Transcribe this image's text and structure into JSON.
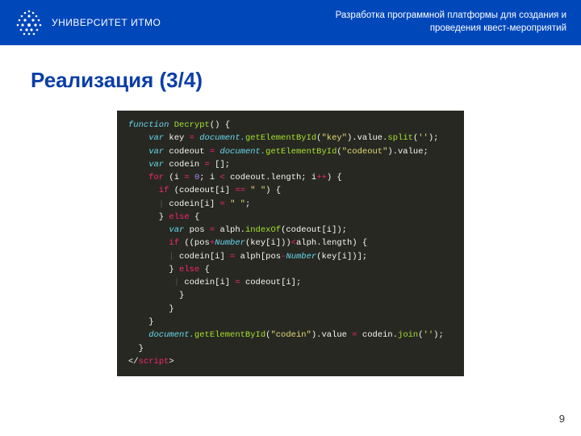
{
  "header": {
    "university": "УНИВЕРСИТЕТ ИТМО",
    "description_line1": "Разработка программной платформы для создания и",
    "description_line2": "проведения квест-мероприятий"
  },
  "slide": {
    "title": "Реализация (3/4)",
    "page_number": "9"
  },
  "code": {
    "l1a": "function",
    "l1b": " Decrypt",
    "l1c": "() {",
    "l2a": "    var",
    "l2b": " key ",
    "l2c": "=",
    "l2d": " document.",
    "l2e": "getElementById",
    "l2f": "(",
    "l2g": "\"key\"",
    "l2h": ").value.",
    "l2i": "split",
    "l2j": "(",
    "l2k": "''",
    "l2l": ");",
    "l3a": "    var",
    "l3b": " codeout ",
    "l3c": "=",
    "l3d": " document.",
    "l3e": "getElementById",
    "l3f": "(",
    "l3g": "\"codeout\"",
    "l3h": ").value;",
    "l4a": "    var",
    "l4b": " codein ",
    "l4c": "=",
    "l4d": " [];",
    "l5a": "    for",
    "l5b": " (i ",
    "l5c": "=",
    "l5d": " ",
    "l5e": "0",
    "l5f": "; i ",
    "l5g": "<",
    "l5h": " codeout.length; i",
    "l5i": "++",
    "l5j": ") {",
    "l6a": "      if",
    "l6b": " (codeout[i] ",
    "l6c": "==",
    "l6d": " ",
    "l6e": "\" \"",
    "l6f": ") {",
    "l7a": "      ",
    "l7g": "|",
    "l7b": " codein[i] ",
    "l7c": "=",
    "l7d": " ",
    "l7e": "\" \"",
    "l7f": ";",
    "l8a": "      } ",
    "l8b": "else",
    "l8c": " {",
    "l9a": "        var",
    "l9b": " pos ",
    "l9c": "=",
    "l9d": " alph.",
    "l9e": "indexOf",
    "l9f": "(codeout[i]);",
    "l10a": "        if",
    "l10b": " ((pos",
    "l10c": "+",
    "l10d": "Number",
    "l10e": "(key[i]))",
    "l10f": "<",
    "l10g": "alph.length) {",
    "l11a": "        ",
    "l11g": "|",
    "l11b": " codein[i] ",
    "l11c": "=",
    "l11d": " alph[pos",
    "l11e": "-",
    "l11f": "Number",
    "l11h": "(key[i])];",
    "l12a": "        } ",
    "l12b": "else",
    "l12c": " {",
    "l13a": "         ",
    "l13g": "|",
    "l13b": " codein[i] ",
    "l13c": "=",
    "l13d": " codeout[i];",
    "l14a": "          }",
    "l15a": "        }",
    "l16a": "    }",
    "l17a": "    document.",
    "l17b": "getElementById",
    "l17c": "(",
    "l17d": "\"codein\"",
    "l17e": ").value ",
    "l17f": "=",
    "l17g": " codein.",
    "l17h": "join",
    "l17i": "(",
    "l17j": "''",
    "l17k": ");",
    "l18a": "  }",
    "l19a": "</",
    "l19b": "script",
    "l19c": ">"
  }
}
